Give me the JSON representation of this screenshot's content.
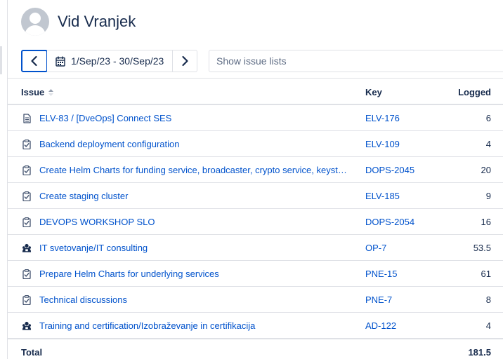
{
  "header": {
    "user_name": "Vid Vranjek"
  },
  "toolbar": {
    "date_range": "1/Sep/23 - 30/Sep/23",
    "issue_lists_placeholder": "Show issue lists"
  },
  "table": {
    "columns": {
      "issue": "Issue",
      "key": "Key",
      "logged": "Logged"
    },
    "rows": [
      {
        "icon": "document-icon",
        "summary": "ELV-83 / [DveOps] Connect SES",
        "key": "ELV-176",
        "logged": "6"
      },
      {
        "icon": "clipboard-check-icon",
        "summary": "Backend deployment configuration",
        "key": "ELV-109",
        "logged": "4"
      },
      {
        "icon": "clipboard-check-icon",
        "summary": "Create Helm Charts for funding service, broadcaster, crypto service, keystore service",
        "key": "DOPS-2045",
        "logged": "20"
      },
      {
        "icon": "clipboard-check-icon",
        "summary": "Create staging cluster",
        "key": "ELV-185",
        "logged": "9"
      },
      {
        "icon": "clipboard-check-icon",
        "summary": "DEVOPS WORKSHOP SLO",
        "key": "DOPS-2054",
        "logged": "16"
      },
      {
        "icon": "people-icon",
        "summary": "IT svetovanje/IT consulting",
        "key": "OP-7",
        "logged": "53.5"
      },
      {
        "icon": "clipboard-check-icon",
        "summary": "Prepare Helm Charts for underlying services",
        "key": "PNE-15",
        "logged": "61"
      },
      {
        "icon": "clipboard-check-icon",
        "summary": "Technical discussions",
        "key": "PNE-7",
        "logged": "8"
      },
      {
        "icon": "people-icon",
        "summary": "Training and certification/Izobraževanje in certifikacija",
        "key": "AD-122",
        "logged": "4"
      }
    ],
    "total": {
      "label": "Total",
      "value": "181.5"
    }
  },
  "colors": {
    "link": "#0052cc",
    "text": "#172b4d",
    "border": "#dfe1e6",
    "accent": "#0052cc"
  }
}
